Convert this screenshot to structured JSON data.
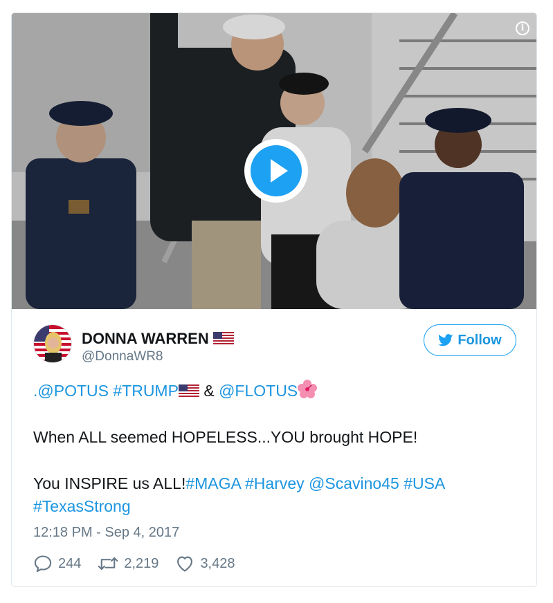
{
  "media": {
    "info_label": "i",
    "play_icon": "play-icon"
  },
  "author": {
    "name": "DONNA WARREN",
    "handle": "@DonnaWR8",
    "flag_icon": "us-flag-icon"
  },
  "follow_button": {
    "label": "Follow",
    "icon": "twitter-bird-icon"
  },
  "tweet": {
    "line1": {
      "mention1": ".@POTUS",
      "hashtag1": "#TRUMP",
      "amp": " & ",
      "mention2": "@FLOTUS"
    },
    "line2": "When ALL seemed HOPELESS...YOU brought HOPE!",
    "line3": {
      "text": "You INSPIRE us ALL!",
      "links": [
        "#MAGA",
        "#Harvey",
        "@Scavino45",
        "#USA",
        "#TexasStrong"
      ]
    }
  },
  "timestamp": "12:18 PM - Sep 4, 2017",
  "actions": {
    "replies": "244",
    "retweets": "2,219",
    "likes": "3,428"
  },
  "colors": {
    "link": "#1b95e0",
    "accent": "#1da1f2",
    "muted": "#657786",
    "text": "#14171a",
    "border": "#e1e8ed"
  }
}
